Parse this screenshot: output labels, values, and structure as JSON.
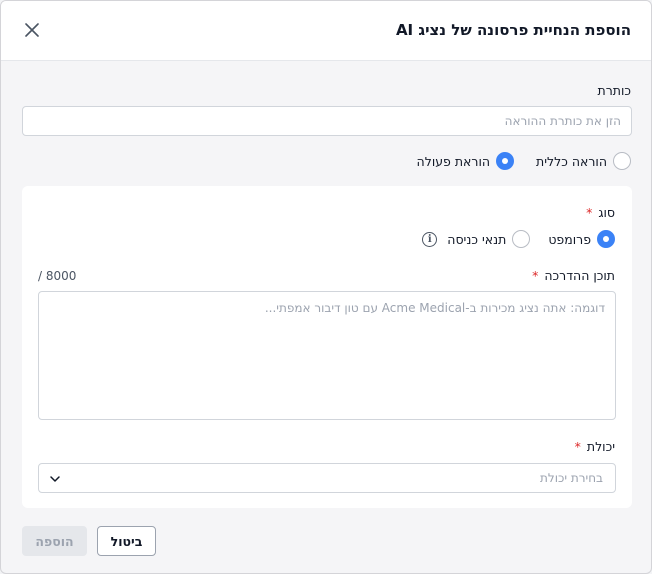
{
  "dialog": {
    "title": "הוספת הנחיית פרסונה של נציג AI"
  },
  "title_field": {
    "label": "כותרת",
    "placeholder": "הזן את כותרת ההוראה",
    "value": ""
  },
  "instruction_kind": {
    "options": [
      {
        "label": "הוראה כללית",
        "selected": false
      },
      {
        "label": "הוראת פעולה",
        "selected": true
      }
    ]
  },
  "type_field": {
    "label": "סוג",
    "required_mark": "*",
    "options": [
      {
        "label": "פרומפט",
        "selected": true
      },
      {
        "label": "תנאי כניסה",
        "selected": false
      }
    ],
    "info_icon": "info-icon"
  },
  "guidance_field": {
    "label": "תוכן ההדרכה",
    "required_mark": "*",
    "counter_current": "0",
    "counter_max": "/ 800",
    "placeholder": "דוגמה: אתה נציג מכירות ב-Acme Medical עם טון דיבור אמפתי...",
    "value": ""
  },
  "capability_field": {
    "label": "יכולת",
    "required_mark": "*",
    "placeholder": "בחירת יכולת",
    "value": ""
  },
  "footer": {
    "cancel_label": "ביטול",
    "add_label": "הוספה",
    "add_enabled": false
  },
  "colors": {
    "accent": "#3b82f6",
    "required": "#dc2626",
    "disabled_bg": "#e5e7eb"
  }
}
